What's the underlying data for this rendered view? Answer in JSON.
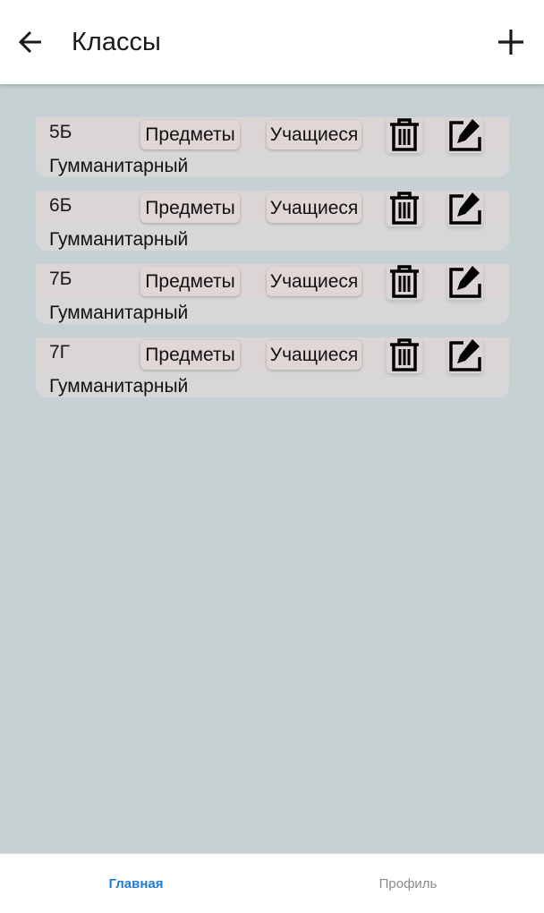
{
  "header": {
    "title": "Классы",
    "back_icon": "arrow-left-icon",
    "add_icon": "plus-icon"
  },
  "classes": [
    {
      "name": "5Б",
      "profile": "Гумманитарный",
      "subjects_label": "Предметы",
      "students_label": "Учащиеся"
    },
    {
      "name": "6Б",
      "profile": "Гумманитарный",
      "subjects_label": "Предметы",
      "students_label": "Учащиеся"
    },
    {
      "name": "7Б",
      "profile": "Гумманитарный",
      "subjects_label": "Предметы",
      "students_label": "Учащиеся"
    },
    {
      "name": "7Г",
      "profile": "Гумманитарный",
      "subjects_label": "Предметы",
      "students_label": "Учащиеся"
    }
  ],
  "bottom_nav": {
    "home_label": "Главная",
    "profile_label": "Профиль"
  },
  "colors": {
    "accent": "#1e7be0",
    "background": "#c5d1d2"
  }
}
